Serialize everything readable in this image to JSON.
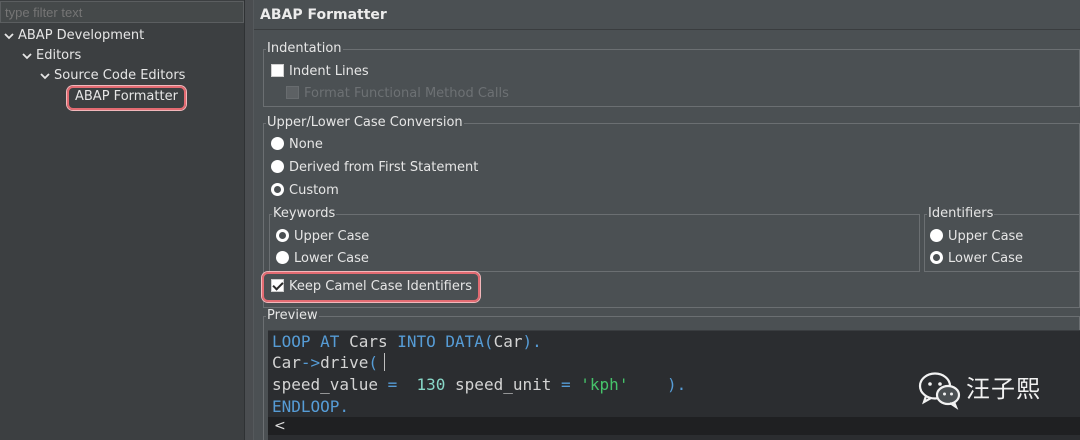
{
  "filter": {
    "placeholder": "type filter text"
  },
  "tree": {
    "items": [
      {
        "label": "ABAP Development"
      },
      {
        "label": "Editors"
      },
      {
        "label": "Source Code Editors"
      },
      {
        "label": "ABAP Formatter"
      }
    ]
  },
  "header": {
    "title": "ABAP Formatter"
  },
  "indentation": {
    "legend": "Indentation",
    "indent_lines": "Indent Lines",
    "format_functional": "Format Functional Method Calls"
  },
  "case_conversion": {
    "legend": "Upper/Lower Case Conversion",
    "options": [
      "None",
      "Derived from First Statement",
      "Custom"
    ],
    "selected": "Custom"
  },
  "keywords": {
    "legend": "Keywords",
    "options": [
      "Upper Case",
      "Lower Case"
    ],
    "selected": "Upper Case"
  },
  "identifiers": {
    "legend": "Identifiers",
    "options": [
      "Upper Case",
      "Lower Case"
    ],
    "selected": "Lower Case"
  },
  "keep_camel": {
    "label": "Keep Camel Case Identifiers",
    "checked": true
  },
  "preview": {
    "legend": "Preview",
    "line1": {
      "kw1": "LOOP AT",
      "id1": " Cars ",
      "kw2": "INTO DATA(",
      "id2": "Car",
      "kw3": ")."
    },
    "line2": {
      "id": "Car",
      "kw": "->",
      "method": "drive",
      "kw2": "("
    },
    "line3": {
      "a": "speed_value ",
      "eq": "=",
      "sp": "  ",
      "num": "130",
      "b": " speed_unit ",
      "eq2": "=",
      "sp2": " ",
      "str": "'kph'",
      "sp3": "    ",
      "end": ")."
    },
    "line4": {
      "kw": "ENDLOOP."
    }
  },
  "watermark": {
    "text": "汪子熙",
    "icon": "wechat-icon"
  }
}
